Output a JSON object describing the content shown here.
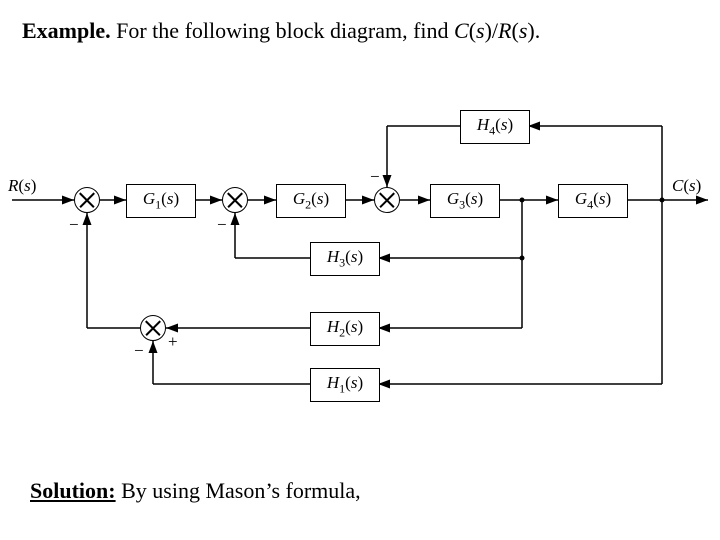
{
  "prompt": {
    "bold_lead": "Example.",
    "text_1": " For the following block diagram, find ",
    "ratio_html": "C(s)/R(s)."
  },
  "solution": {
    "bold_lead": "Solution:",
    "text_1": " By using Mason’s formula,"
  },
  "labels": {
    "input": "R(s)",
    "output": "C(s)"
  },
  "blocks": {
    "g1": "G₁(s)",
    "g2": "G₂(s)",
    "g3": "G₃(s)",
    "g4": "G₄(s)",
    "h1": "H₁(s)",
    "h2": "H₂(s)",
    "h3": "H₃(s)",
    "h4": "H₄(s)"
  },
  "signs": {
    "minus": "−",
    "plus": "+"
  },
  "chart_data": {
    "type": "block-diagram",
    "input": "R(s)",
    "output": "C(s)",
    "forward_path_blocks": [
      "G1(s)",
      "G2(s)",
      "G3(s)",
      "G4(s)"
    ],
    "summing_junctions": [
      {
        "id": "S1",
        "inputs": [
          {
            "from": "R(s)",
            "sign": "+"
          },
          {
            "from": "S4",
            "sign": "-"
          }
        ],
        "out_to": "G1(s)"
      },
      {
        "id": "S2",
        "inputs": [
          {
            "from": "G1(s)",
            "sign": "+"
          },
          {
            "from": "H3(s)",
            "sign": "-"
          }
        ],
        "out_to": "G2(s)"
      },
      {
        "id": "S3",
        "inputs": [
          {
            "from": "G2(s)",
            "sign": "+"
          },
          {
            "from": "H4(s)",
            "sign": "-"
          }
        ],
        "out_to": "G3(s)"
      },
      {
        "id": "S4",
        "inputs": [
          {
            "from": "H2(s)",
            "sign": "+"
          },
          {
            "from": "H1(s)",
            "sign": "-"
          }
        ],
        "out_to": "S1_feedback"
      }
    ],
    "feedback_blocks": [
      {
        "name": "H4(s)",
        "from_node_after": "G4(s) output (C(s))",
        "to_sum": "S3",
        "sign": "-"
      },
      {
        "name": "H3(s)",
        "from_node_after": "G3(s)",
        "to_sum": "S2",
        "sign": "-"
      },
      {
        "name": "H2(s)",
        "from_node_after": "G3(s)",
        "to_sum": "S4",
        "sign": "+"
      },
      {
        "name": "H1(s)",
        "from_node_after": "G4(s) output (C(s))",
        "to_sum": "S4",
        "sign": "-"
      }
    ],
    "transfer_function_target": "C(s)/R(s)"
  }
}
